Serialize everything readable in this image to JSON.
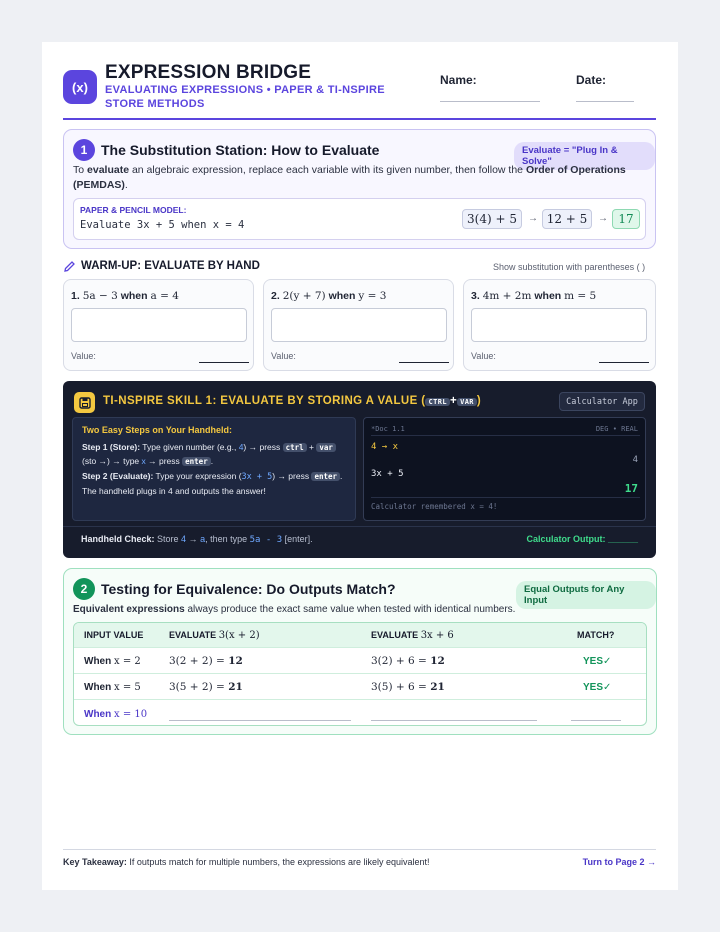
{
  "header": {
    "logo": "(x)",
    "title": "EXPRESSION BRIDGE",
    "subtitle": "EVALUATING EXPRESSIONS • PAPER & TI-NSPIRE STORE METHODS",
    "name_label": "Name:",
    "date_label": "Date:"
  },
  "section1": {
    "number": "1",
    "title": "The Substitution Station: How to Evaluate",
    "pill": "Evaluate = \"Plug In & Solve\"",
    "intro_a": "To ",
    "intro_bold1": "evaluate",
    "intro_b": " an algebraic expression, replace each variable with its given number, then follow the ",
    "intro_bold2": "Order of Operations (PEMDAS)",
    "intro_c": ".",
    "model_label": "PAPER & PENCIL MODEL:",
    "model_text": "Evaluate 3x + 5 when x = 4",
    "step1": "3(4) + 5",
    "step2": "12 + 5",
    "step3": "17",
    "arrow": "→"
  },
  "warmup": {
    "title": "WARM-UP: EVALUATE BY HAND",
    "hint": "Show substitution with parentheses ( )",
    "value_label": "Value:",
    "problems": [
      {
        "num": "1.",
        "expr": "5a − 3",
        "when": "when",
        "cond": "a = 4"
      },
      {
        "num": "2.",
        "expr": "2(y + 7)",
        "when": "when",
        "cond": "y = 3"
      },
      {
        "num": "3.",
        "expr": "4m + 2m",
        "when": "when",
        "cond": "m = 5"
      }
    ]
  },
  "tinspire": {
    "title_pre": "TI-NSPIRE SKILL 1: EVALUATE BY STORING A VALUE (",
    "key_ctrl": "CTRL",
    "plus": "+",
    "key_var": "VAR",
    "title_post": ")",
    "app_button": "Calculator App",
    "steps_title": "Two Easy Steps on Your Handheld:",
    "step1_label": "Step 1 (Store):",
    "step1_a": " Type given number (e.g., ",
    "step1_num": "4",
    "step1_b": ") → press ",
    "kbd_ctrl": "ctrl",
    "kbd_plus": " + ",
    "kbd_var": "var",
    "step1_c": " (sto →) → type ",
    "step1_x": "x",
    "step1_d": " → press ",
    "kbd_enter": "enter",
    "step1_e": ".",
    "step2_label": "Step 2 (Evaluate):",
    "step2_a": " Type your expression (",
    "step2_expr": "3x + 5",
    "step2_b": ") → press ",
    "step2_c": ". The handheld plugs in 4 and outputs the answer!",
    "screen_doc": "*Doc 1.1",
    "screen_mode": "DEG • REAL",
    "screen_line1": "4 → x",
    "screen_out1": "4",
    "screen_line2": "3x + 5",
    "screen_out2": "17",
    "screen_note": "Calculator remembered x = 4!",
    "check_label": "Handheld Check:",
    "check_a": " Store ",
    "check_num": "4",
    "check_arrow": " → ",
    "check_var": "a",
    "check_b": ", then type ",
    "check_expr": "5a - 3",
    "check_c": " [enter].",
    "output_label": "Calculator Output: ______"
  },
  "section2": {
    "number": "2",
    "title": "Testing for Equivalence: Do Outputs Match?",
    "pill": "Equal Outputs for Any Input",
    "intro_bold": "Equivalent expressions",
    "intro_rest": " always produce the exact same value when tested with identical numbers.",
    "col1": "INPUT VALUE",
    "col2_pre": "EVALUATE",
    "col2_expr": "3(x + 2)",
    "col3_pre": "EVALUATE",
    "col3_expr": "3x + 6",
    "col4": "MATCH?",
    "rows": [
      {
        "when": "When",
        "x": "x = 2",
        "a_expr": "3(2 + 2) =",
        "a_val": "12",
        "b_expr": "3(2) + 6 =",
        "b_val": "12",
        "match": "YES✓"
      },
      {
        "when": "When",
        "x": "x = 5",
        "a_expr": "3(5 + 2) =",
        "a_val": "21",
        "b_expr": "3(5) + 6 =",
        "b_val": "21",
        "match": "YES✓"
      }
    ],
    "last_when": "When",
    "last_x": "x = 10"
  },
  "footer": {
    "takeaway_label": "Key Takeaway:",
    "takeaway_text": " If outputs match for multiple numbers, the expressions are likely equivalent!",
    "next": "Turn to Page 2 →"
  },
  "colors": {
    "accent": "#5b45de",
    "green": "#12945a",
    "dark": "#171c2c",
    "yellow": "#f4c840"
  }
}
